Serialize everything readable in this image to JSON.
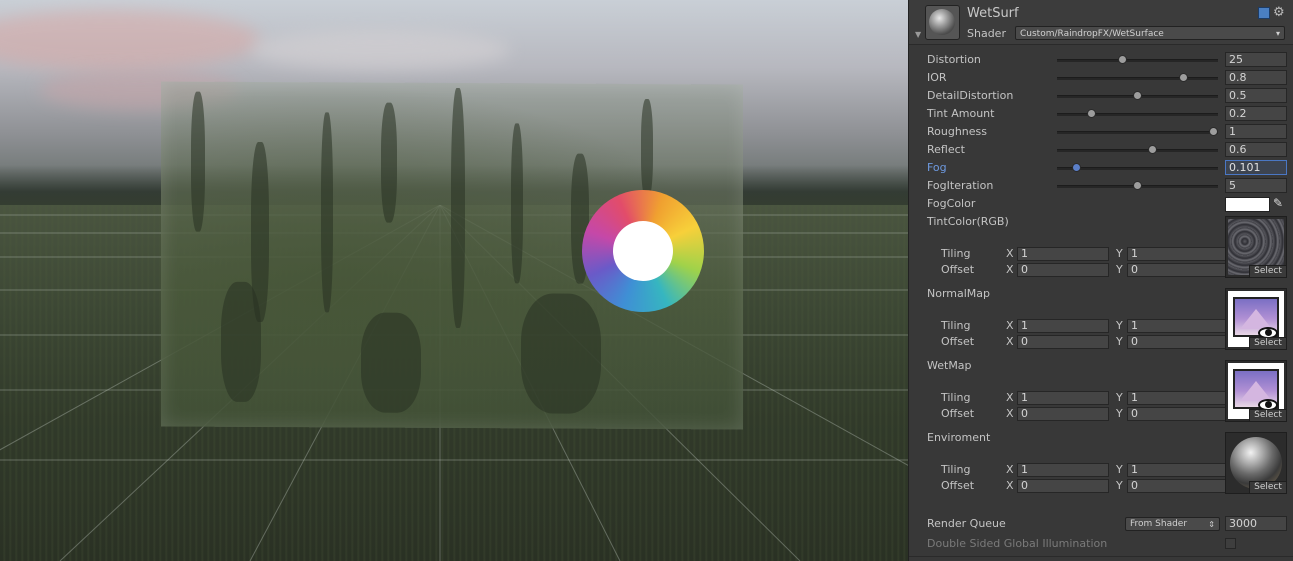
{
  "material": {
    "name": "WetSurf",
    "shader_label": "Shader",
    "shader": "Custom/RaindropFX/WetSurface"
  },
  "properties": [
    {
      "label": "Distortion",
      "value": "25",
      "slider": 0.4
    },
    {
      "label": "IOR",
      "value": "0.8",
      "slider": 0.8
    },
    {
      "label": "DetailDistortion",
      "value": "0.5",
      "slider": 0.5
    },
    {
      "label": "Tint Amount",
      "value": "0.2",
      "slider": 0.2
    },
    {
      "label": "Roughness",
      "value": "1",
      "slider": 1.0
    },
    {
      "label": "Reflect",
      "value": "0.6",
      "slider": 0.6
    },
    {
      "label": "Fog",
      "value": "0.101",
      "slider": 0.1,
      "active": true
    },
    {
      "label": "FogIteration",
      "value": "5",
      "slider": 0.5
    }
  ],
  "fog_color": {
    "label": "FogColor",
    "color": "#ffffff"
  },
  "textures": [
    {
      "label": "TintColor(RGB)",
      "tiling_x": "1",
      "tiling_y": "1",
      "offset_x": "0",
      "offset_y": "0",
      "select": "Select",
      "thumb": "noise-texture"
    },
    {
      "label": "NormalMap",
      "tiling_x": "1",
      "tiling_y": "1",
      "offset_x": "0",
      "offset_y": "0",
      "select": "Select",
      "thumb": "image-icon"
    },
    {
      "label": "WetMap",
      "tiling_x": "1",
      "tiling_y": "1",
      "offset_x": "0",
      "offset_y": "0",
      "select": "Select",
      "thumb": "image-icon"
    },
    {
      "label": "Enviroment",
      "tiling_x": "1",
      "tiling_y": "1",
      "offset_x": "0",
      "offset_y": "0",
      "select": "Select",
      "thumb": "chrome-sphere"
    }
  ],
  "tex_labels": {
    "tiling": "Tiling",
    "offset": "Offset",
    "x": "X",
    "y": "Y"
  },
  "render_queue": {
    "label": "Render Queue",
    "mode": "From Shader",
    "value": "3000"
  },
  "double_sided": {
    "label": "Double Sided Global Illumination",
    "checked": false
  },
  "icons": {
    "book": "book-icon",
    "gear": "gear-icon",
    "eyedropper": "eyedropper-icon"
  },
  "colors": {
    "accent": "#5b7fc8",
    "panel": "#383838"
  }
}
